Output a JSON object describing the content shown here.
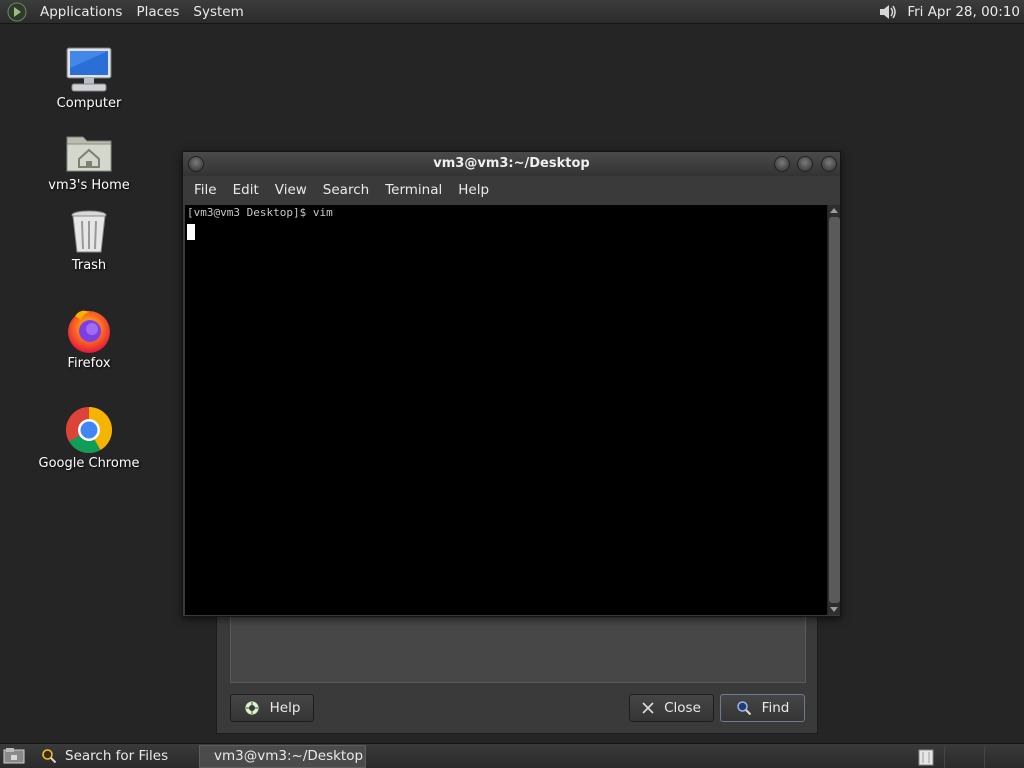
{
  "top_panel": {
    "menus": [
      "Applications",
      "Places",
      "System"
    ],
    "clock": "Fri Apr 28, 00:10"
  },
  "desktop_icons": [
    {
      "label": "Computer",
      "icon": "computer-icon"
    },
    {
      "label": "vm3's Home",
      "icon": "home-folder-icon"
    },
    {
      "label": "Trash",
      "icon": "trash-icon"
    },
    {
      "label": "Firefox",
      "icon": "firefox-icon"
    },
    {
      "label": "Google Chrome",
      "icon": "chrome-icon"
    }
  ],
  "terminal": {
    "title": "vm3@vm3:~/Desktop",
    "menus": [
      "File",
      "Edit",
      "View",
      "Search",
      "Terminal",
      "Help"
    ],
    "prompt_line": "[vm3@vm3 Desktop]$ vim"
  },
  "search_dialog": {
    "help_label": "Help",
    "close_label": "Close",
    "find_label": "Find"
  },
  "taskbar": {
    "items": [
      "Search for Files",
      "vm3@vm3:~/Desktop"
    ]
  },
  "colors": {
    "desktop_bg": "#252525",
    "panel_bg": "#333333",
    "terminal_bg": "#000000"
  }
}
